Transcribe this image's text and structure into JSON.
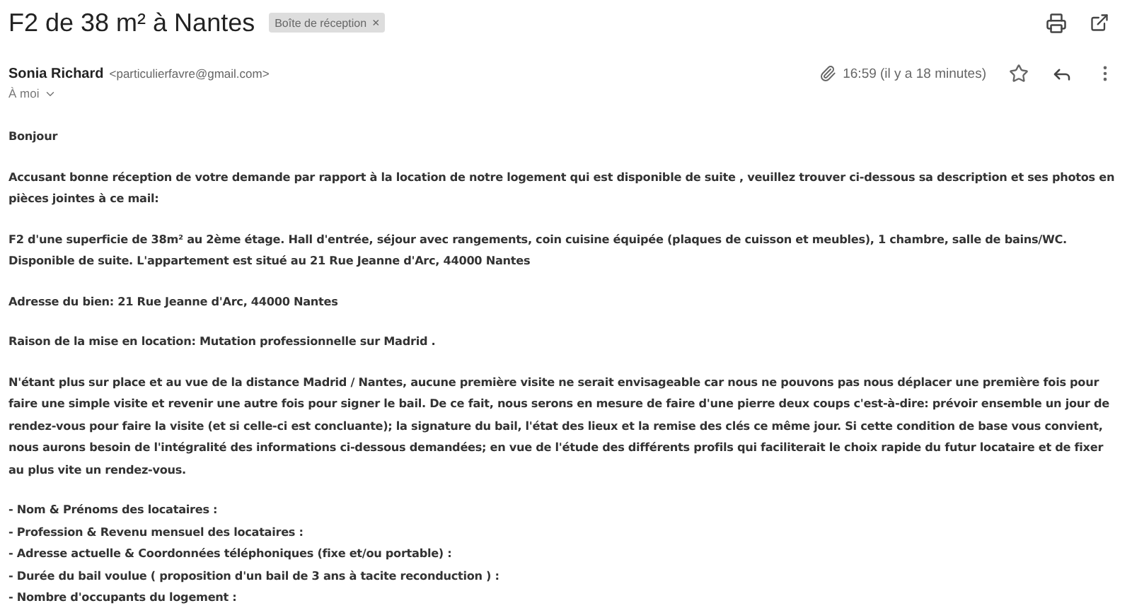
{
  "subject": "F2 de 38 m² à Nantes",
  "label": {
    "text": "Boîte de réception",
    "close": "×"
  },
  "sender": {
    "name": "Sonia Richard",
    "email": "<particulierfavre@gmail.com>",
    "recipient": "À moi",
    "time": "16:59 (il y a 18 minutes)",
    "starred": false
  },
  "body": {
    "paragraphs": [
      "Bonjour",
      "Accusant bonne réception de votre demande par rapport à la location de notre logement qui est disponible de suite , veuillez trouver ci-dessous sa description et ses photos en pièces jointes à ce mail:",
      "F2 d'une superficie de 38m² au 2ème étage. Hall d'entrée, séjour avec rangements, coin cuisine équipée (plaques de cuisson et meubles), 1 chambre, salle de bains/WC. Disponible de suite. L'appartement est situé au 21 Rue Jeanne d'Arc, 44000 Nantes",
      "Adresse du bien: 21 Rue Jeanne d'Arc, 44000 Nantes",
      "Raison de la mise en location: Mutation professionnelle sur Madrid .",
      "N'étant plus sur place et au vue de la distance Madrid / Nantes, aucune première visite ne serait envisageable car nous ne pouvons pas nous déplacer une première fois pour faire une simple visite et revenir une autre fois pour signer le bail. De ce fait, nous serons en mesure de faire d'une pierre deux coups c'est-à-dire: prévoir ensemble un jour de rendez-vous pour faire la visite (et si celle-ci est concluante); la signature du bail, l'état des lieux et la remise des clés ce même jour. Si cette condition de base vous convient, nous aurons besoin de l'intégralité des informations ci-dessous demandées; en vue de l'étude des différents profils qui faciliterait le choix rapide du futur locataire et de fixer au plus vite un rendez-vous."
    ],
    "list": [
      "- Nom & Prénoms des locataires :",
      "- Profession & Revenu mensuel des locataires :",
      "- Adresse actuelle & Coordonnées téléphoniques (fixe et/ou portable) :",
      "- Durée du bail voulue ( proposition d'un bail de 3 ans à tacite reconduction ) :",
      "- Nombre d'occupants du logement :"
    ]
  }
}
